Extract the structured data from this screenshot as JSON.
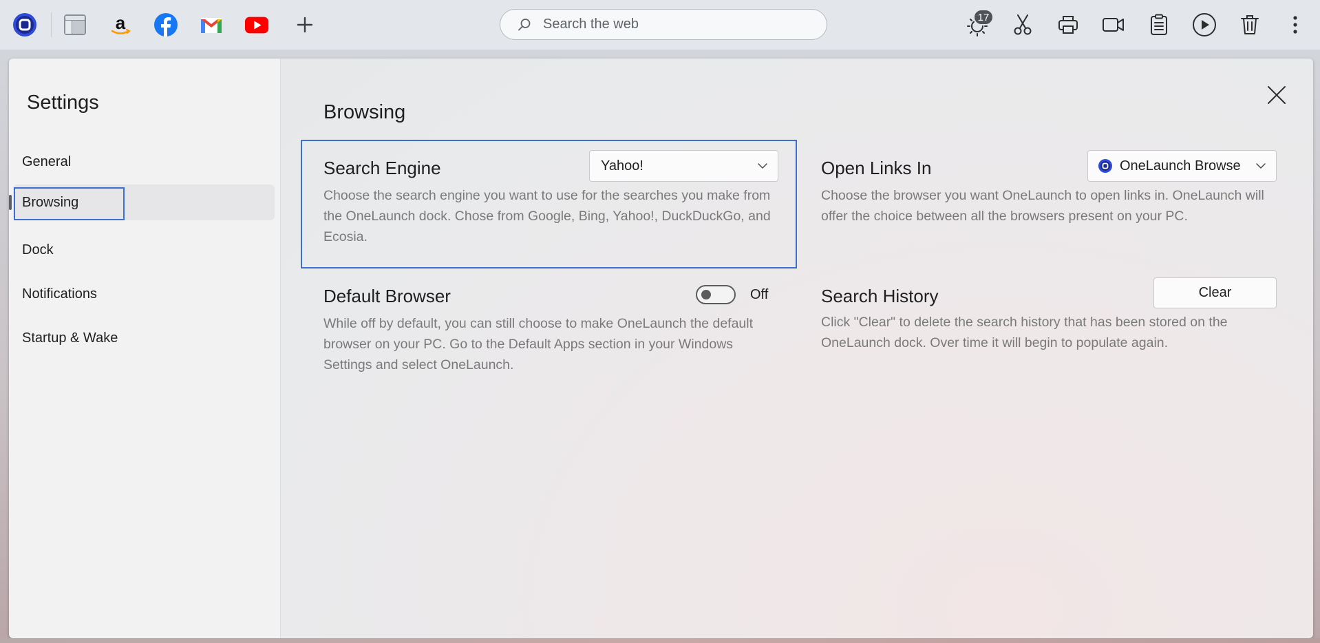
{
  "dock": {
    "apps": [
      {
        "name": "onelaunch-icon"
      },
      {
        "name": "notes-app-icon"
      },
      {
        "name": "amazon-icon"
      },
      {
        "name": "facebook-icon"
      },
      {
        "name": "gmail-icon"
      },
      {
        "name": "youtube-icon"
      },
      {
        "name": "add-icon"
      }
    ],
    "search_placeholder": "Search the web",
    "weather_badge": "17",
    "tools": [
      "weather-icon",
      "scissors-icon",
      "printer-icon",
      "video-camera-icon",
      "clipboard-icon",
      "play-icon",
      "trash-icon",
      "more-options-icon"
    ]
  },
  "sidebar": {
    "title": "Settings",
    "items": [
      {
        "label": "General"
      },
      {
        "label": "Browsing"
      },
      {
        "label": "Dock"
      },
      {
        "label": "Notifications"
      },
      {
        "label": "Startup & Wake"
      }
    ],
    "active_index": 1
  },
  "main": {
    "title": "Browsing",
    "search_engine": {
      "title": "Search Engine",
      "value": "Yahoo!",
      "description": "Choose the search engine you want to use for the searches you make from the OneLaunch dock. Chose from Google, Bing, Yahoo!, DuckDuckGo, and Ecosia."
    },
    "open_links_in": {
      "title": "Open Links In",
      "value": "OneLaunch Browse",
      "description": "Choose the browser you want OneLaunch to open links in. OneLaunch will offer the choice between all the browsers present on your PC."
    },
    "default_browser": {
      "title": "Default Browser",
      "toggle_state": "Off",
      "description": "While off by default, you can still choose to make OneLaunch the default browser on your PC. Go to the Default Apps section in your Windows Settings and select OneLaunch."
    },
    "search_history": {
      "title": "Search History",
      "button_label": "Clear",
      "description": "Click \"Clear\" to delete the search history that has been stored on the OneLaunch dock. Over time it will begin to populate again."
    }
  },
  "colors": {
    "focus_ring": "#3c6fcf",
    "youtube_red": "#ff0000",
    "facebook_blue": "#1877f2",
    "amazon_orange": "#ff9900",
    "onelaunch_blue": "#2f4bd8"
  }
}
